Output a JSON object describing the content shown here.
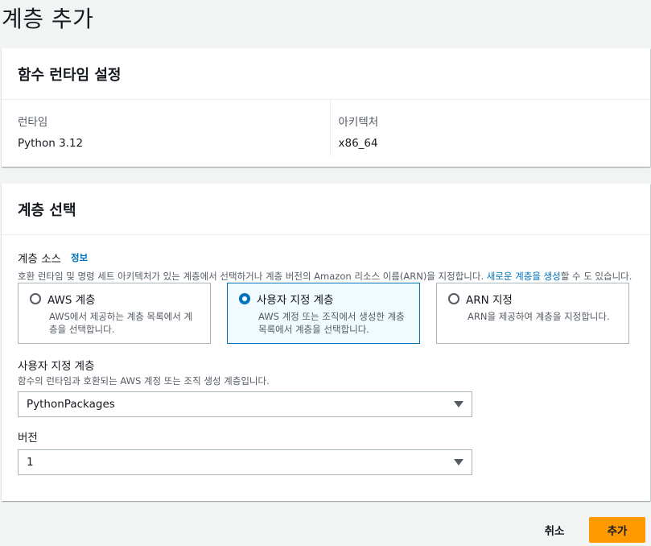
{
  "page": {
    "title": "계층 추가"
  },
  "runtime_panel": {
    "title": "함수 런타임 설정",
    "runtime_label": "런타임",
    "runtime_value": "Python 3.12",
    "arch_label": "아키텍처",
    "arch_value": "x86_64"
  },
  "layer_panel": {
    "title": "계층 선택",
    "source_label": "계층 소스",
    "info_link": "정보",
    "source_desc_1": "호환 런타임 및 명령 세트 아키텍처가 있는 계층에서 선택하거나 계층 버전의 Amazon 리소스 이름(ARN)을 지정합니다. ",
    "source_desc_link": "새로운 계층을 생성",
    "source_desc_2": "할 수 도 있습니다.",
    "tiles": [
      {
        "title": "AWS 계층",
        "desc": "AWS에서 제공하는 계층 목록에서 계층을 선택합니다.",
        "selected": false
      },
      {
        "title": "사용자 지정 계층",
        "desc": "AWS 계정 또는 조직에서 생성한 계층 목록에서 계층을 선택합니다.",
        "selected": true
      },
      {
        "title": "ARN 지정",
        "desc": "ARN을 제공하여 계층을 지정합니다.",
        "selected": false
      }
    ],
    "custom_label": "사용자 지정 계층",
    "custom_desc": "함수의 런타임과 호환되는 AWS 계정 또는 조직 생성 계층입니다.",
    "custom_value": "PythonPackages",
    "version_label": "버전",
    "version_value": "1"
  },
  "footer": {
    "cancel_label": "취소",
    "add_label": "추가"
  },
  "colors": {
    "primary": "#ff9900",
    "link": "#0073bb",
    "selected_bg": "#f1faff"
  }
}
